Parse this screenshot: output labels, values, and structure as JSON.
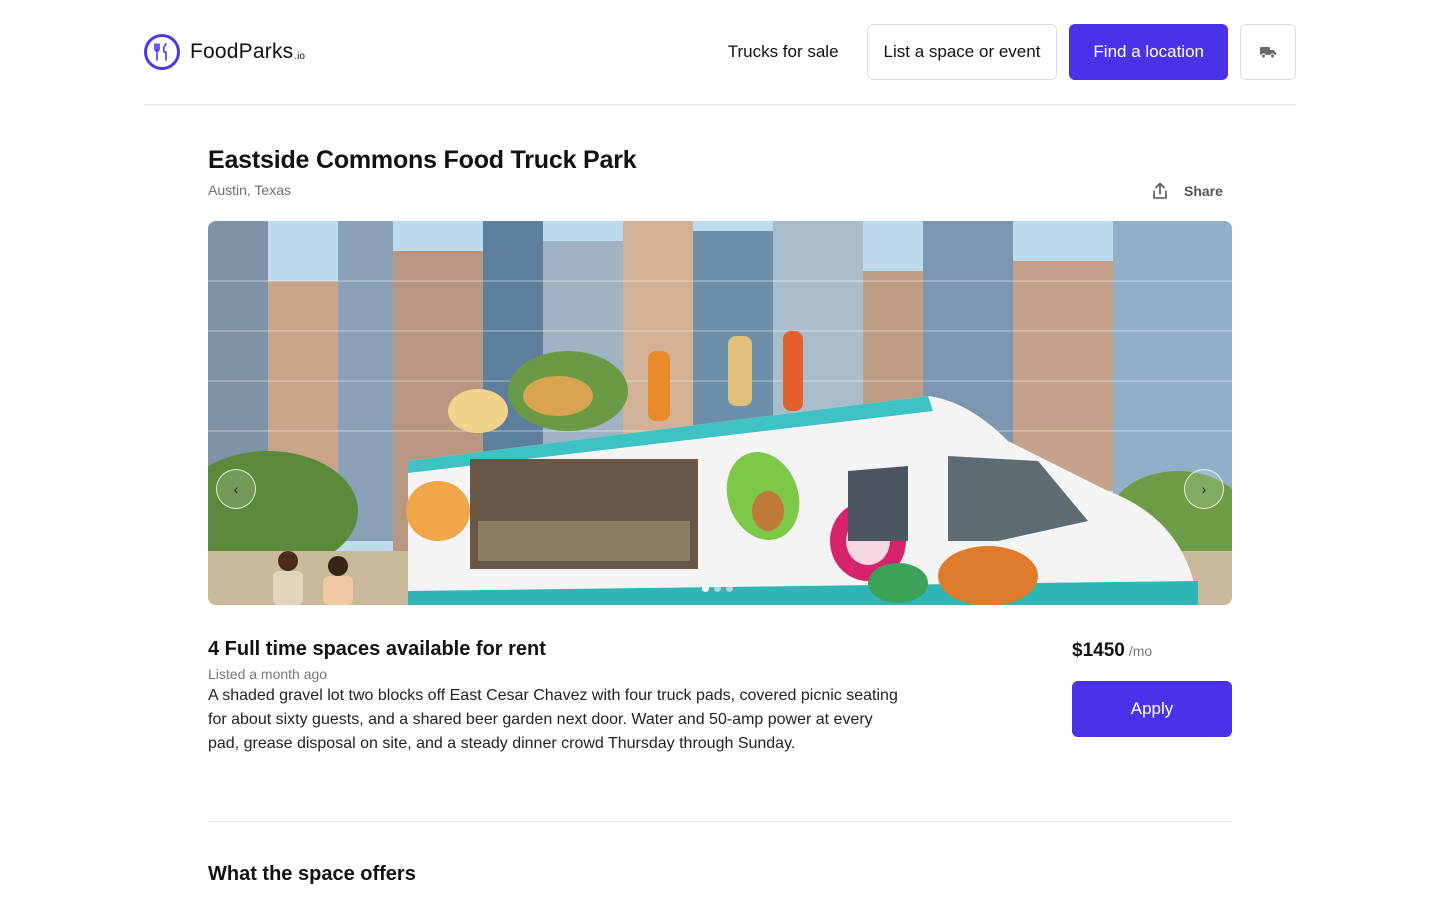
{
  "brand": {
    "name": "FoodParks",
    "tld": ".io",
    "color": "#4a32e8"
  },
  "nav": {
    "trucks_for_sale": "Trucks for sale",
    "list_space": "List a space or event",
    "find_location": "Find a location",
    "truck_icon": "truck-icon"
  },
  "listing": {
    "title": "Eastside Commons Food Truck Park",
    "location": "Austin, Texas",
    "share_label": "Share",
    "heading": "4 Full time spaces available for rent",
    "listed": "Listed a month ago",
    "description": "A shaded gravel lot two blocks off East Cesar Chavez with four truck pads, covered picnic seating for about sixty guests, and a shared beer garden next door. Water and 50-amp power at every pad, grease disposal on site, and a steady dinner crowd Thursday through Sunday.",
    "price": "$1450",
    "price_unit": "/mo",
    "apply_label": "Apply",
    "offers_heading": "What the space offers"
  },
  "gallery": {
    "image": "food-truck-city-skyline-photo",
    "prev_icon": "chevron-left-icon",
    "next_icon": "chevron-right-icon",
    "slide_count": 3,
    "active_slide": 1
  }
}
